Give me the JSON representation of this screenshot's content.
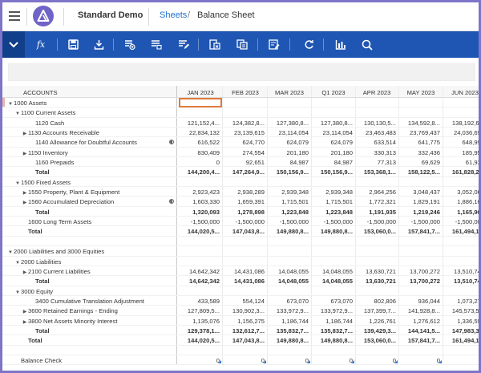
{
  "header": {
    "app_title": "Standard Demo",
    "breadcrumb": {
      "link": "Sheets",
      "separator": "/",
      "current": "Balance Sheet"
    }
  },
  "toolbar": {
    "buttons": [
      "chevron-down-icon",
      "fx-icon",
      "save-icon",
      "download-icon",
      "insert-rows-icon",
      "insert-cols-icon",
      "edit-cell-icon",
      "format-icon",
      "copy-icon",
      "edit-list-icon",
      "refresh-icon",
      "chart-icon",
      "search-icon"
    ]
  },
  "grid": {
    "account_header": "ACCOUNTS",
    "columns": [
      "JAN 2023",
      "FEB 2023",
      "MAR 2023",
      "Q1 2023",
      "APR 2023",
      "MAY 2023",
      "JUN 2023"
    ],
    "rows": [
      {
        "label": "1000 Assets",
        "indent": 0,
        "toggle": "down",
        "values": [
          "",
          "",
          "",
          "",
          "",
          "",
          ""
        ]
      },
      {
        "label": "1100 Current Assets",
        "indent": 1,
        "toggle": "down",
        "values": [
          "",
          "",
          "",
          "",
          "",
          "",
          ""
        ]
      },
      {
        "label": "1120 Cash",
        "indent": 3,
        "toggle": "",
        "values": [
          "121,152,4...",
          "124,382,8...",
          "127,380,8...",
          "127,380,8...",
          "130,130,5...",
          "134,592,8...",
          "138,192,6..."
        ]
      },
      {
        "label": "1130 Accounts Receivable",
        "indent": 2,
        "toggle": "right",
        "values": [
          "22,834,132",
          "23,139,615",
          "23,114,054",
          "23,114,054",
          "23,463,483",
          "23,769,437",
          "24,036,699"
        ]
      },
      {
        "label": "1140 Allowance for Doubtful Accounts",
        "indent": 3,
        "toggle": "",
        "info": true,
        "values": [
          "616,522",
          "624,770",
          "624,079",
          "624,079",
          "633,514",
          "641,775",
          "648,991"
        ]
      },
      {
        "label": "1150 Inventory",
        "indent": 2,
        "toggle": "right",
        "values": [
          "830,409",
          "274,554",
          "201,180",
          "201,180",
          "330,313",
          "332,436",
          "185,955"
        ]
      },
      {
        "label": "1160 Prepaids",
        "indent": 3,
        "toggle": "",
        "values": [
          "0",
          "92,651",
          "84,987",
          "84,987",
          "77,313",
          "69,629",
          "61,935"
        ]
      },
      {
        "label": "Total",
        "indent": 3,
        "toggle": "",
        "bold": true,
        "values": [
          "144,200,4...",
          "147,264,9...",
          "150,156,9...",
          "150,156,9...",
          "153,368,1...",
          "158,122,5...",
          "161,828,2..."
        ]
      },
      {
        "label": "1500 Fixed Assets",
        "indent": 1,
        "toggle": "down",
        "values": [
          "",
          "",
          "",
          "",
          "",
          "",
          ""
        ]
      },
      {
        "label": "1550 Property, Plant & Equipment",
        "indent": 2,
        "toggle": "right",
        "values": [
          "2,923,423",
          "2,938,289",
          "2,939,348",
          "2,939,348",
          "2,964,256",
          "3,048,437",
          "3,052,063"
        ]
      },
      {
        "label": "1560 Accumulated Depreciation",
        "indent": 2,
        "toggle": "right",
        "info": true,
        "values": [
          "1,603,330",
          "1,659,391",
          "1,715,501",
          "1,715,501",
          "1,772,321",
          "1,829,191",
          "1,886,162"
        ]
      },
      {
        "label": "Total",
        "indent": 3,
        "toggle": "",
        "bold": true,
        "values": [
          "1,320,093",
          "1,278,898",
          "1,223,848",
          "1,223,848",
          "1,191,935",
          "1,219,246",
          "1,165,901"
        ]
      },
      {
        "label": "1600 Long Term Assets",
        "indent": 2,
        "toggle": "",
        "values": [
          "-1,500,000",
          "-1,500,000",
          "-1,500,000",
          "-1,500,000",
          "-1,500,000",
          "-1,500,000",
          "-1,500,000"
        ]
      },
      {
        "label": "Total",
        "indent": 2,
        "toggle": "",
        "bold": true,
        "values": [
          "144,020,5...",
          "147,043,8...",
          "149,880,8...",
          "149,880,8...",
          "153,060,0...",
          "157,841,7...",
          "161,494,1..."
        ]
      },
      {
        "label": "",
        "indent": 0,
        "toggle": "",
        "values": [
          "",
          "",
          "",
          "",
          "",
          "",
          ""
        ]
      },
      {
        "label": "2000 Liabilities and 3000 Equities",
        "indent": 0,
        "toggle": "down",
        "values": [
          "",
          "",
          "",
          "",
          "",
          "",
          ""
        ]
      },
      {
        "label": "2000 Liabilities",
        "indent": 1,
        "toggle": "down",
        "values": [
          "",
          "",
          "",
          "",
          "",
          "",
          ""
        ]
      },
      {
        "label": "2100 Current Liabilities",
        "indent": 2,
        "toggle": "right",
        "values": [
          "14,642,342",
          "14,431,086",
          "14,048,055",
          "14,048,055",
          "13,630,721",
          "13,700,272",
          "13,510,745"
        ]
      },
      {
        "label": "Total",
        "indent": 3,
        "toggle": "",
        "bold": true,
        "values": [
          "14,642,342",
          "14,431,086",
          "14,048,055",
          "14,048,055",
          "13,630,721",
          "13,700,272",
          "13,510,745"
        ]
      },
      {
        "label": "3000 Equity",
        "indent": 1,
        "toggle": "down",
        "values": [
          "",
          "",
          "",
          "",
          "",
          "",
          ""
        ]
      },
      {
        "label": "3400 Cumulative Translation Adjustment",
        "indent": 3,
        "toggle": "",
        "values": [
          "433,589",
          "554,124",
          "673,070",
          "673,070",
          "802,806",
          "936,044",
          "1,073,277"
        ]
      },
      {
        "label": "3600 Retained Earnings - Ending",
        "indent": 2,
        "toggle": "right",
        "values": [
          "127,809,5...",
          "130,902,3...",
          "133,972,9...",
          "133,972,9...",
          "137,399,7...",
          "141,928,8...",
          "145,573,5..."
        ]
      },
      {
        "label": "3800 Net Assets Minority Interest",
        "indent": 2,
        "toggle": "right",
        "values": [
          "1,135,076",
          "1,156,275",
          "1,186,744",
          "1,186,744",
          "1,226,761",
          "1,276,612",
          "1,336,592"
        ]
      },
      {
        "label": "Total",
        "indent": 3,
        "toggle": "",
        "bold": true,
        "values": [
          "129,378,1...",
          "132,612,7...",
          "135,832,7...",
          "135,832,7...",
          "139,429,3...",
          "144,141,5...",
          "147,983,3..."
        ]
      },
      {
        "label": "Total",
        "indent": 2,
        "toggle": "",
        "bold": true,
        "values": [
          "144,020,5...",
          "147,043,8...",
          "149,880,8...",
          "149,880,8...",
          "153,060,0...",
          "157,841,7...",
          "161,494,1..."
        ]
      },
      {
        "label": "",
        "indent": 0,
        "toggle": "",
        "values": [
          "",
          "",
          "",
          "",
          "",
          "",
          ""
        ]
      },
      {
        "label": "Balance Check",
        "indent": 1,
        "toggle": "",
        "values": [
          "0",
          "0",
          "0",
          "0",
          "0",
          "0",
          "0"
        ]
      }
    ]
  }
}
